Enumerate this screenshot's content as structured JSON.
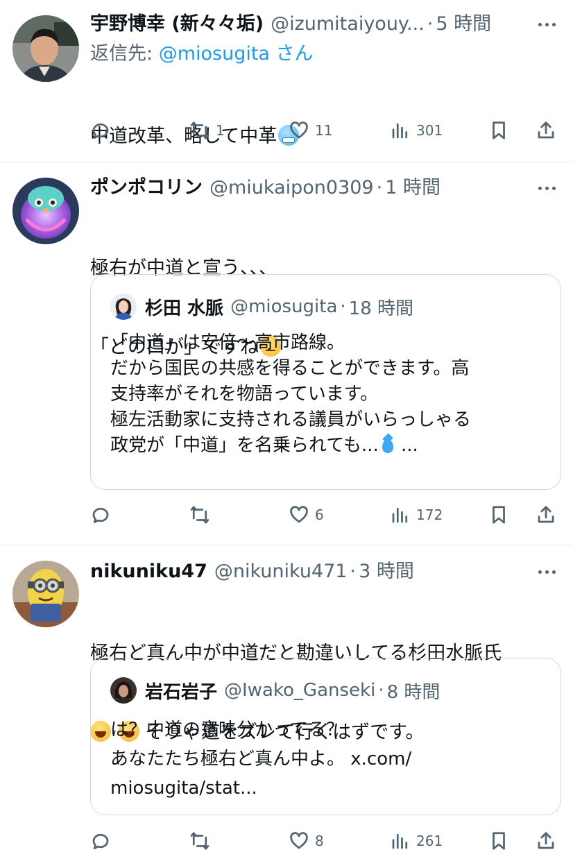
{
  "tweets": [
    {
      "name": "宇野博幸 (新々々垢)",
      "handle": "@izumitaiyouy...",
      "sep": "·",
      "time": "5 時間",
      "reply_to_prefix": "返信先: ",
      "reply_to_handle": "@miosugita",
      "reply_to_suffix": " さん",
      "text_lines": [
        "中道改革、略して中革"
      ],
      "emoji_after_text": "cold-face",
      "actions": {
        "replies": "",
        "retweets": "1",
        "likes": "11",
        "views": "301"
      }
    },
    {
      "name": "ポンポコリン",
      "handle": "@miukaipon0309",
      "sep": "·",
      "time": "1 時間",
      "text_lines": [
        "極右が中道と宣う、、、",
        "「どの口が」ですね"
      ],
      "emoji_after_text": "face-with-raised-eyebrow",
      "quote": {
        "name": "杉田 水脈",
        "handle": "@miosugita",
        "sep": "·",
        "time": "18 時間",
        "text_lines": [
          "「中道」は安倍〜高市路線。",
          "だから国民の共感を得ることができます。高",
          "支持率がそれを物語っています。",
          "極左活動家に支持される議員がいらっしゃる",
          "政党が「中道」を名乗られても..."
        ],
        "trailing": " ...",
        "emoji": "droplet"
      },
      "actions": {
        "replies": "",
        "retweets": "",
        "likes": "6",
        "views": "172"
      }
    },
    {
      "name": "nikuniku47",
      "handle": "@nikuniku471",
      "sep": "·",
      "time": "3 時間",
      "text_lines": [
        "極右ど真ん中が中道だと勘違いしてる杉田水脈氏",
        "そりゃ道をズレて行くはずです。"
      ],
      "emoji_line2_prefix": [
        "face-with-tears-of-joy",
        "face-with-tears-of-joy"
      ],
      "quote": {
        "name": "岩石岩子",
        "handle": "@Iwako_Ganseki",
        "sep": "·",
        "time": "8 時間",
        "text_lines": [
          "は？中道の意味分かってる？",
          "あなたたち極右ど真ん中よ。 x.com/",
          "miosugita/stat..."
        ]
      },
      "actions": {
        "replies": "",
        "retweets": "",
        "likes": "8",
        "views": "261"
      }
    }
  ],
  "icons": [
    "reply-icon",
    "retweet-icon",
    "like-icon",
    "views-icon",
    "bookmark-icon",
    "share-icon",
    "more-icon"
  ],
  "colors": {
    "text": "#0f1419",
    "secondary": "#536471",
    "link": "#1d9bf0",
    "border": "#cfd9de",
    "divider": "#e6e9ec"
  }
}
